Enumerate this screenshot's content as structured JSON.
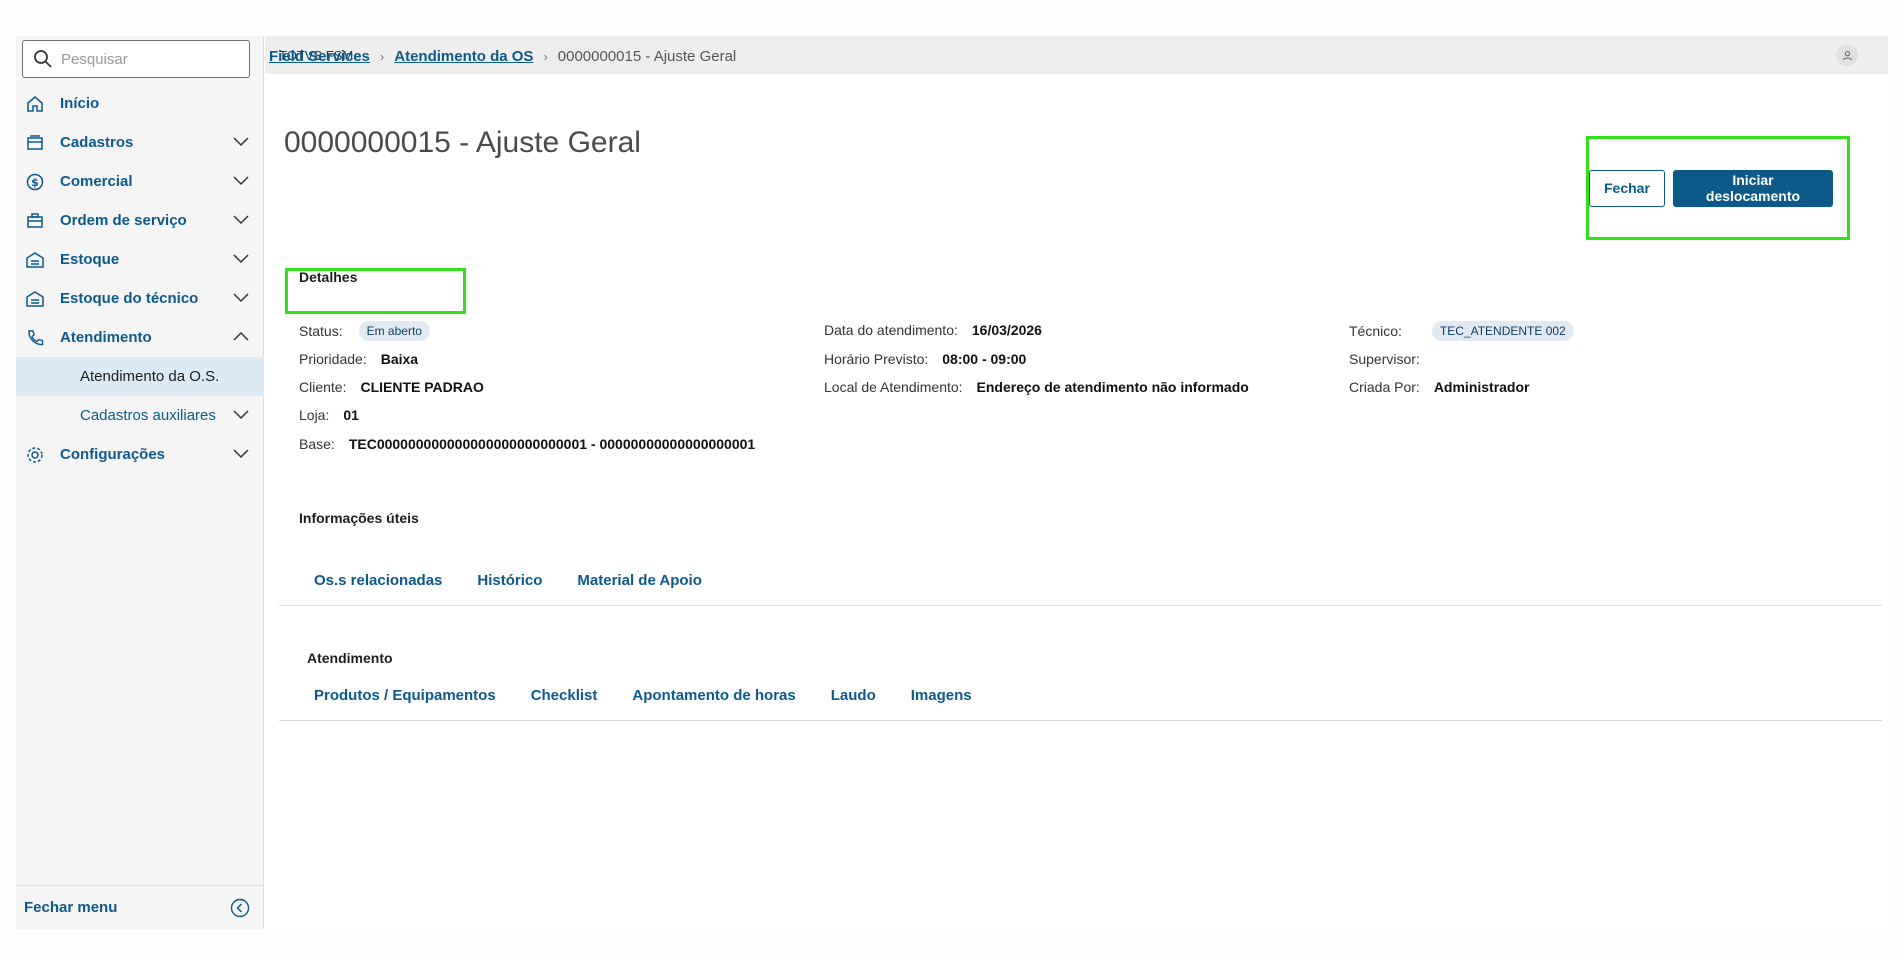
{
  "search": {
    "placeholder": "Pesquisar"
  },
  "sidebar": {
    "items": [
      {
        "label": "Início"
      },
      {
        "label": "Cadastros"
      },
      {
        "label": "Comercial"
      },
      {
        "label": "Ordem de serviço"
      },
      {
        "label": "Estoque"
      },
      {
        "label": "Estoque do técnico"
      },
      {
        "label": "Atendimento"
      },
      {
        "label": "Atendimento da O.S."
      },
      {
        "label": "Cadastros auxiliares"
      },
      {
        "label": "Configurações"
      }
    ],
    "footer_label": "Fechar menu"
  },
  "header": {
    "app_title": "TOTVS FSM"
  },
  "breadcrumb": {
    "root": "Field Services",
    "parent": "Atendimento da OS",
    "current": "0000000015 - Ajuste Geral"
  },
  "page": {
    "title": "0000000015 - Ajuste Geral"
  },
  "actions": {
    "close_label": "Fechar",
    "start_label": "Iniciar deslocamento"
  },
  "details": {
    "section_label": "Detalhes",
    "status_label": "Status:",
    "status_value": "Em aberto",
    "priority_label": "Prioridade:",
    "priority_value": "Baixa",
    "client_label": "Cliente:",
    "client_value": "CLIENTE PADRAO",
    "store_label": "Loja:",
    "store_value": "01",
    "base_label": "Base:",
    "base_value": "TEC000000000000000000000000001 - 00000000000000000001",
    "date_label": "Data do atendimento:",
    "date_value": "16/03/2026",
    "time_label": "Horário Previsto:",
    "time_value": "08:00 - 09:00",
    "location_label": "Local de Atendimento:",
    "location_value": "Endereço de atendimento não informado",
    "tech_label": "Técnico:",
    "tech_value": "TEC_ATENDENTE 002",
    "supervisor_label": "Supervisor:",
    "created_label": "Criada Por:",
    "created_value": "Administrador"
  },
  "useful_info": {
    "section_label": "Informações úteis",
    "tabs": [
      "Os.s relacionadas",
      "Histórico",
      "Material de Apoio"
    ]
  },
  "service": {
    "section_label": "Atendimento",
    "tabs": [
      "Produtos / Equipamentos",
      "Checklist",
      "Apontamento de horas",
      "Laudo",
      "Imagens"
    ]
  },
  "colors": {
    "accent": "#0c5a8a",
    "highlight": "#32e01c",
    "active_bg": "#dbeaf5"
  }
}
